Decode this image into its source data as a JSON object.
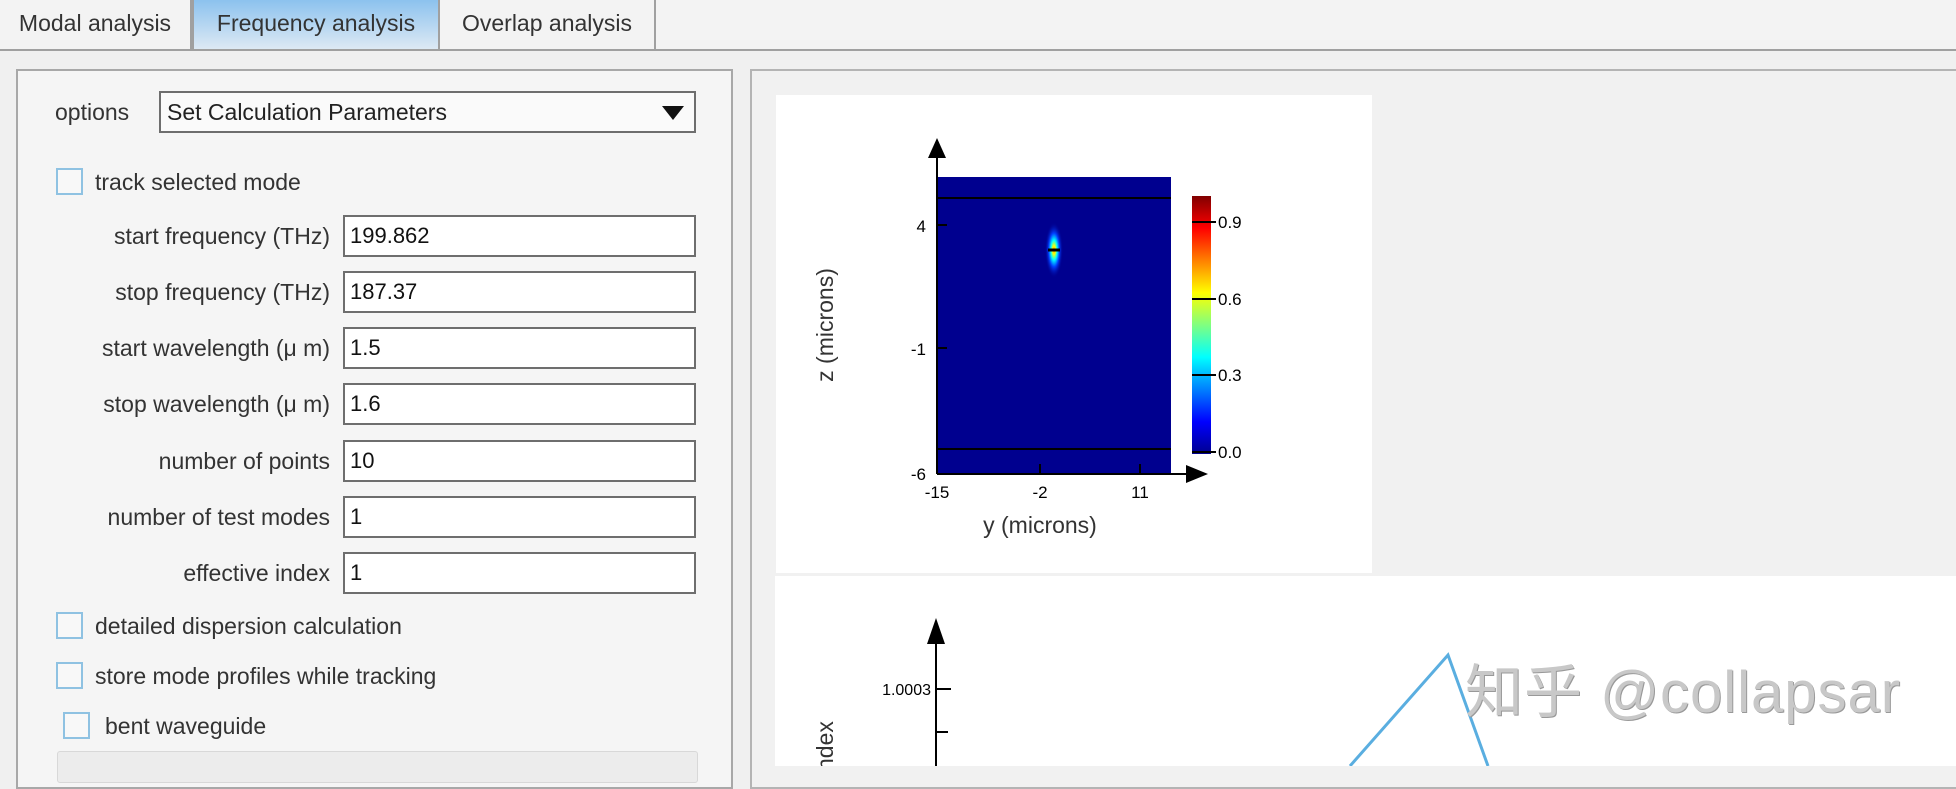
{
  "tabs": [
    {
      "label": "Modal analysis",
      "active": false
    },
    {
      "label": "Frequency analysis",
      "active": true
    },
    {
      "label": "Overlap analysis",
      "active": false
    }
  ],
  "options": {
    "label": "options",
    "selected": "Set Calculation Parameters"
  },
  "checkboxes": {
    "track_selected_mode": {
      "label": "track selected mode",
      "checked": false
    },
    "detailed_dispersion": {
      "label": "detailed dispersion calculation",
      "checked": false
    },
    "store_profiles": {
      "label": "store mode profiles while tracking",
      "checked": false
    },
    "bent_waveguide": {
      "label": "bent waveguide",
      "checked": false
    }
  },
  "fields": [
    {
      "label": "start frequency (THz)",
      "value": "199.862"
    },
    {
      "label": "stop frequency (THz)",
      "value": "187.37"
    },
    {
      "label": "start wavelength (μ m)",
      "value": "1.5"
    },
    {
      "label": "stop wavelength (μ m)",
      "value": "1.6"
    },
    {
      "label": "number of points",
      "value": "10"
    },
    {
      "label": "number of test modes",
      "value": "1"
    },
    {
      "label": "effective index",
      "value": "1"
    }
  ],
  "chart_data": [
    {
      "type": "heatmap",
      "xlabel": "y (microns)",
      "ylabel": "z (microns)",
      "xticks": [
        "-15",
        "-2",
        "11"
      ],
      "yticks": [
        "4",
        "-1",
        "-6"
      ],
      "xlim": [
        -15,
        13
      ],
      "ylim": [
        -6,
        8
      ],
      "peak": {
        "y": 0,
        "z": 2.5,
        "value": 1.0
      },
      "colorbar": {
        "ticks": [
          "0.9",
          "0.6",
          "0.3",
          "0.0"
        ],
        "range": [
          0,
          1
        ],
        "colormap": "jet"
      }
    },
    {
      "type": "line",
      "ylabel": "ndex",
      "yticks": [
        "1.0003"
      ],
      "series_color": "#5aaee0"
    }
  ],
  "watermark": "知乎 @collapsar"
}
